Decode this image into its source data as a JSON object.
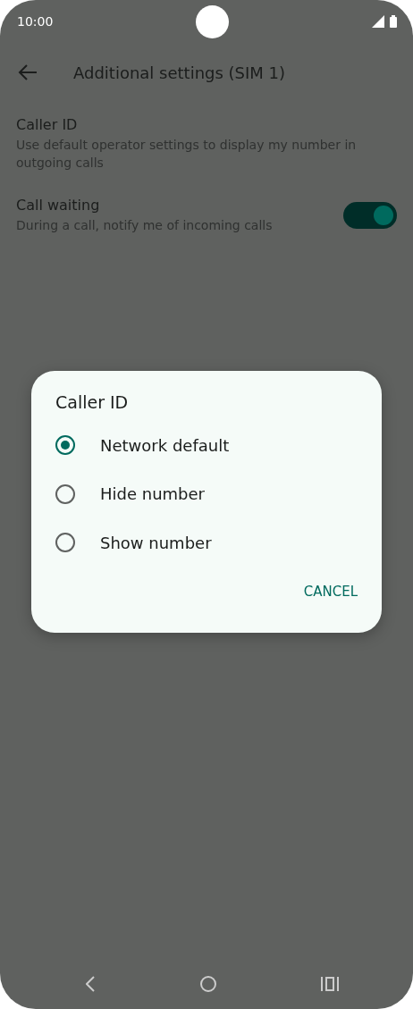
{
  "status_bar": {
    "time": "10:00"
  },
  "toolbar": {
    "title": "Additional settings (SIM 1)"
  },
  "settings": [
    {
      "kind": "text",
      "title": "Caller ID",
      "summary": "Use default operator settings to display my number in outgoing calls"
    },
    {
      "kind": "switch",
      "title": "Call waiting",
      "summary": "During a call, notify me of incoming calls",
      "on": true
    }
  ],
  "dialog": {
    "title": "Caller ID",
    "options": [
      {
        "label": "Network default",
        "selected": true
      },
      {
        "label": "Hide number",
        "selected": false
      },
      {
        "label": "Show number",
        "selected": false
      }
    ],
    "buttons": [
      "CANCEL"
    ]
  }
}
